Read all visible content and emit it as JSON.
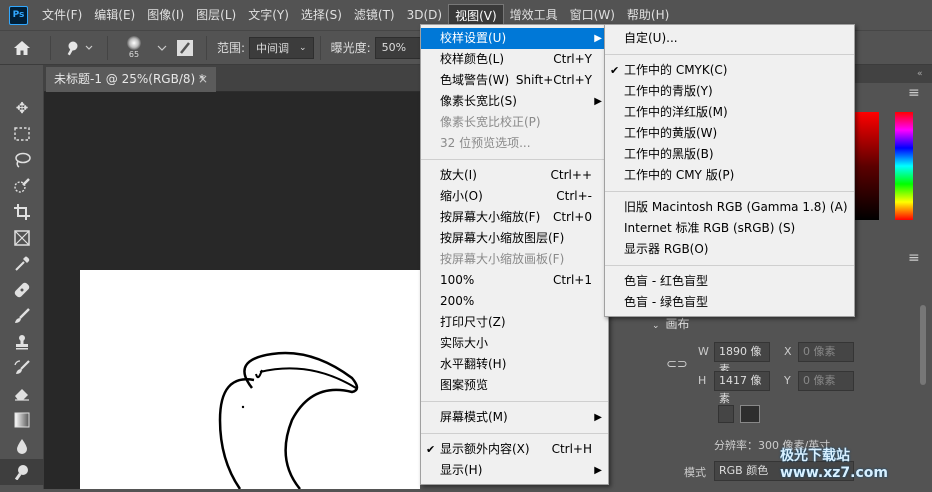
{
  "menubar": {
    "logo": "Ps",
    "items": [
      "文件(F)",
      "编辑(E)",
      "图像(I)",
      "图层(L)",
      "文字(Y)",
      "选择(S)",
      "滤镜(T)",
      "3D(D)",
      "视图(V)",
      "增效工具",
      "窗口(W)",
      "帮助(H)"
    ]
  },
  "options": {
    "brush_size": "65",
    "range_label": "范围:",
    "range_value": "中间调",
    "exposure_label": "曝光度:",
    "exposure_value": "50%"
  },
  "tab": {
    "title": "未标题-1 @ 25%(RGB/8) *",
    "close": "×"
  },
  "view_menu": [
    {
      "label": "校样设置(U)",
      "shortcut": "",
      "submenu": true,
      "highlight": true
    },
    {
      "label": "校样颜色(L)",
      "shortcut": "Ctrl+Y"
    },
    {
      "label": "色域警告(W)",
      "shortcut": "Shift+Ctrl+Y"
    },
    {
      "label": "像素长宽比(S)",
      "shortcut": "",
      "submenu": true
    },
    {
      "label": "像素长宽比校正(P)",
      "shortcut": "",
      "disabled": true
    },
    {
      "label": "32 位预览选项...",
      "shortcut": "",
      "disabled": true
    },
    {
      "sep": true
    },
    {
      "label": "放大(I)",
      "shortcut": "Ctrl++"
    },
    {
      "label": "缩小(O)",
      "shortcut": "Ctrl+-"
    },
    {
      "label": "按屏幕大小缩放(F)",
      "shortcut": "Ctrl+0"
    },
    {
      "label": "按屏幕大小缩放图层(F)",
      "shortcut": ""
    },
    {
      "label": "按屏幕大小缩放画板(F)",
      "shortcut": "",
      "disabled": true
    },
    {
      "label": "100%",
      "shortcut": "Ctrl+1"
    },
    {
      "label": "200%",
      "shortcut": ""
    },
    {
      "label": "打印尺寸(Z)",
      "shortcut": ""
    },
    {
      "label": "实际大小",
      "shortcut": ""
    },
    {
      "label": "水平翻转(H)",
      "shortcut": ""
    },
    {
      "label": "图案预览",
      "shortcut": ""
    },
    {
      "sep": true
    },
    {
      "label": "屏幕模式(M)",
      "shortcut": "",
      "submenu": true
    },
    {
      "sep": true
    },
    {
      "label": "显示额外内容(X)",
      "shortcut": "Ctrl+H",
      "checked": true
    },
    {
      "label": "显示(H)",
      "shortcut": "",
      "submenu": true
    }
  ],
  "proof_submenu": [
    {
      "label": "自定(U)..."
    },
    {
      "sep": true
    },
    {
      "label": "工作中的 CMYK(C)",
      "checked": true
    },
    {
      "label": "工作中的青版(Y)"
    },
    {
      "label": "工作中的洋红版(M)"
    },
    {
      "label": "工作中的黄版(W)"
    },
    {
      "label": "工作中的黑版(B)"
    },
    {
      "label": "工作中的 CMY 版(P)"
    },
    {
      "sep": true
    },
    {
      "label": "旧版 Macintosh RGB (Gamma 1.8) (A)"
    },
    {
      "label": "Internet 标准 RGB (sRGB) (S)"
    },
    {
      "label": "显示器 RGB(O)"
    },
    {
      "sep": true
    },
    {
      "label": "色盲 - 红色盲型"
    },
    {
      "label": "色盲 - 绿色盲型"
    }
  ],
  "properties": {
    "section": "画布",
    "w_label": "W",
    "w_value": "1890 像素",
    "h_label": "H",
    "h_value": "1417 像素",
    "x_label": "X",
    "x_value": "0 像素",
    "y_label": "Y",
    "y_value": "0 像素",
    "resolution": "分辨率：300 像素/英寸",
    "mode_label": "模式",
    "mode_value": "RGB 颜色"
  },
  "watermark": "极光下载站 www.xz7.com",
  "colors": {
    "menu_highlight": "#0078d7",
    "ps_blue": "#31a8ff"
  }
}
